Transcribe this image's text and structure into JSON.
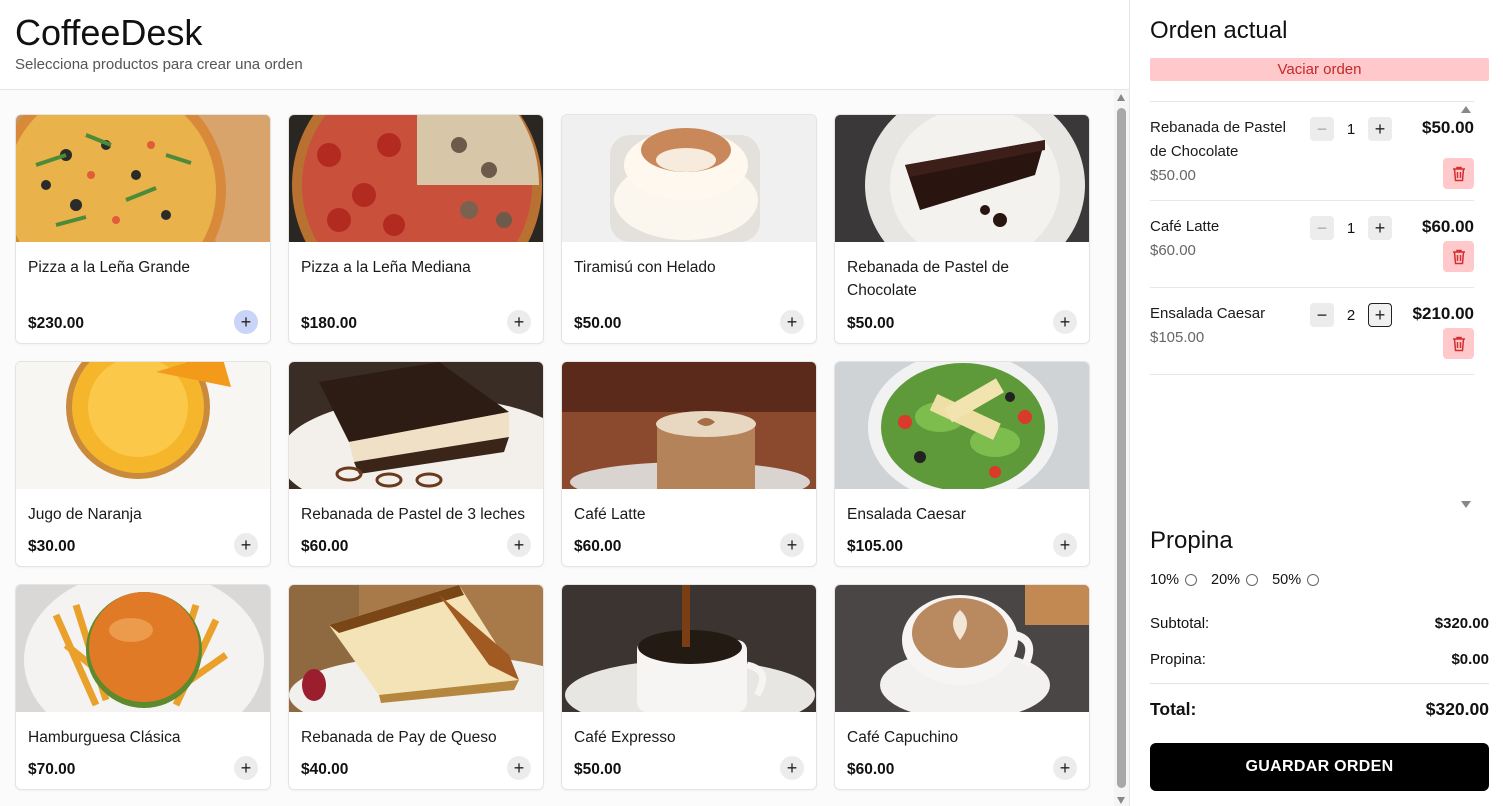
{
  "app": {
    "title": "CoffeeDesk",
    "subtitle": "Selecciona productos para crear una orden"
  },
  "products": [
    {
      "name": "Pizza a la Leña Grande",
      "price": "$230.00",
      "image": "pizza-grande-photo"
    },
    {
      "name": "Pizza a la Leña Mediana",
      "price": "$180.00",
      "image": "pizza-mediana-photo"
    },
    {
      "name": "Tiramisú con Helado",
      "price": "$50.00",
      "image": "tiramisu-photo"
    },
    {
      "name": "Rebanada de Pastel de Chocolate",
      "price": "$50.00",
      "image": "chocolate-cake-photo"
    },
    {
      "name": "Jugo de Naranja",
      "price": "$30.00",
      "image": "orange-juice-photo"
    },
    {
      "name": "Rebanada de Pastel de 3 leches",
      "price": "$60.00",
      "image": "tres-leches-photo"
    },
    {
      "name": "Café Latte",
      "price": "$60.00",
      "image": "latte-photo"
    },
    {
      "name": "Ensalada Caesar",
      "price": "$105.00",
      "image": "caesar-salad-photo"
    },
    {
      "name": "Hamburguesa Clásica",
      "price": "$70.00",
      "image": "burger-photo"
    },
    {
      "name": "Rebanada de Pay de Queso",
      "price": "$40.00",
      "image": "cheesecake-photo"
    },
    {
      "name": "Café Expresso",
      "price": "$50.00",
      "image": "espresso-photo"
    },
    {
      "name": "Café Capuchino",
      "price": "$60.00",
      "image": "cappuccino-photo"
    }
  ],
  "order": {
    "title": "Orden actual",
    "clear_label": "Vaciar orden",
    "items": [
      {
        "name": "Rebanada de Pastel de Chocolate",
        "unit_price": "$50.00",
        "qty": "1",
        "total": "$50.00"
      },
      {
        "name": "Café Latte",
        "unit_price": "$60.00",
        "qty": "1",
        "total": "$60.00"
      },
      {
        "name": "Ensalada Caesar",
        "unit_price": "$105.00",
        "qty": "2",
        "total": "$210.00"
      }
    ],
    "tip": {
      "title": "Propina",
      "options": [
        "10%",
        "20%",
        "50%"
      ]
    },
    "subtotal_label": "Subtotal:",
    "subtotal": "$320.00",
    "tip_label": "Propina:",
    "tip_value": "$0.00",
    "total_label": "Total:",
    "total": "$320.00",
    "save_label": "GUARDAR ORDEN"
  },
  "colors": {
    "danger_bg": "#ffc9cc",
    "danger_text": "#c62828",
    "primary_button": "#000000",
    "add_active": "#c9d5f7"
  }
}
